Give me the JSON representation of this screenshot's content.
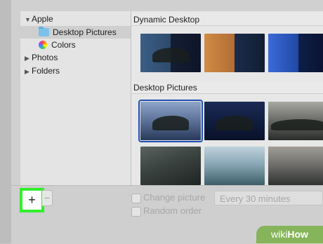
{
  "sidebar": {
    "items": [
      {
        "label": "Apple",
        "disclosure": "▼",
        "icon": "none"
      },
      {
        "label": "Desktop Pictures",
        "disclosure": "",
        "icon": "folder-icon",
        "selected": true
      },
      {
        "label": "Colors",
        "disclosure": "",
        "icon": "color-wheel-icon"
      },
      {
        "label": "Photos",
        "disclosure": "▶",
        "icon": "none"
      },
      {
        "label": "Folders",
        "disclosure": "▶",
        "icon": "none"
      }
    ]
  },
  "content": {
    "sections": [
      {
        "title": "Dynamic Desktop"
      },
      {
        "title": "Desktop Pictures"
      }
    ]
  },
  "bottom": {
    "add_label": "+",
    "remove_label": "−",
    "change_picture_label": "Change picture",
    "random_order_label": "Random order",
    "interval_value": "Every 30 minutes"
  },
  "colors": {
    "highlight": "#33ee2e",
    "selection_outline": "#1f4fb3"
  },
  "watermark": {
    "wiki": "wiki",
    "how": "How"
  }
}
